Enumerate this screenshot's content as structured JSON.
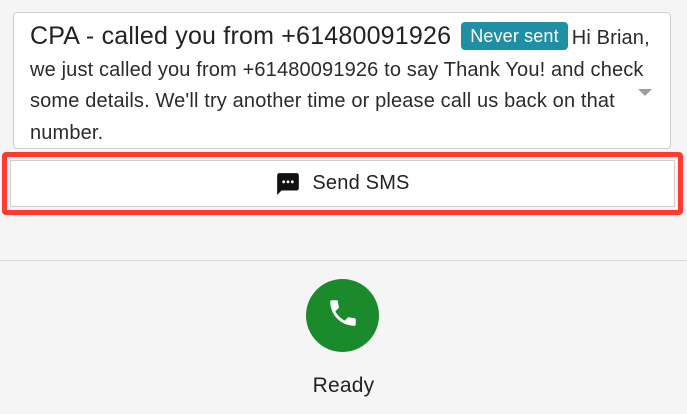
{
  "message": {
    "title": "CPA - called you from +61480091926",
    "status_badge": "Never sent",
    "body": "Hi Brian, we just called you from +61480091926 to say Thank You! and check some details. We'll try another time or please call us back on that number."
  },
  "send_sms": {
    "label": "Send SMS",
    "icon": "message-icon"
  },
  "call": {
    "icon": "phone-icon",
    "status": "Ready",
    "color": "#1b8a2a"
  },
  "colors": {
    "badge": "#1f8fa6",
    "highlight": "#ff3b30"
  }
}
